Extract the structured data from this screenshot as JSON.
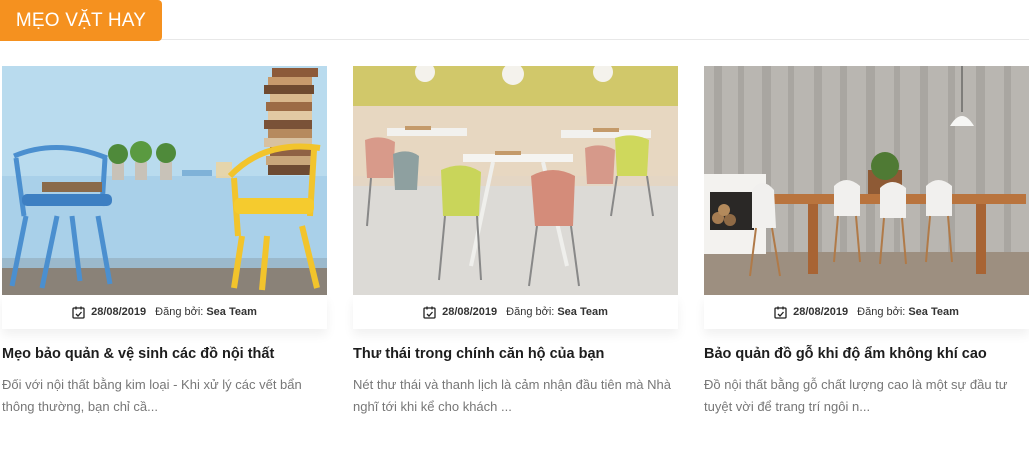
{
  "section": {
    "title": "MẸO VẶT HAY"
  },
  "colors": {
    "accent": "#f5911f"
  },
  "posts": [
    {
      "date": "28/08/2019",
      "author_label": "Đăng bởi:",
      "author": "Sea Team",
      "title": "Mẹo bảo quản & vệ sinh các đồ nội thất",
      "excerpt": "Đối với nội thất bằng kim loại - Khi xử lý các vết bẩn thông thường, bạn chỉ cầ..."
    },
    {
      "date": "28/08/2019",
      "author_label": "Đăng bởi:",
      "author": "Sea Team",
      "title": "Thư thái trong chính căn hộ của bạn",
      "excerpt": "Nét thư thái và thanh lịch là cảm nhận đầu tiên mà Nhà nghĩ tới khi kể cho khách ..."
    },
    {
      "date": "28/08/2019",
      "author_label": "Đăng bởi:",
      "author": "Sea Team",
      "title": "Bảo quản đồ gỗ khi độ ẩm không khí cao",
      "excerpt": "Đồ nội thất bằng gỗ chất lượng cao là một sự đầu tư tuyệt vời để trang trí ngôi n..."
    }
  ]
}
